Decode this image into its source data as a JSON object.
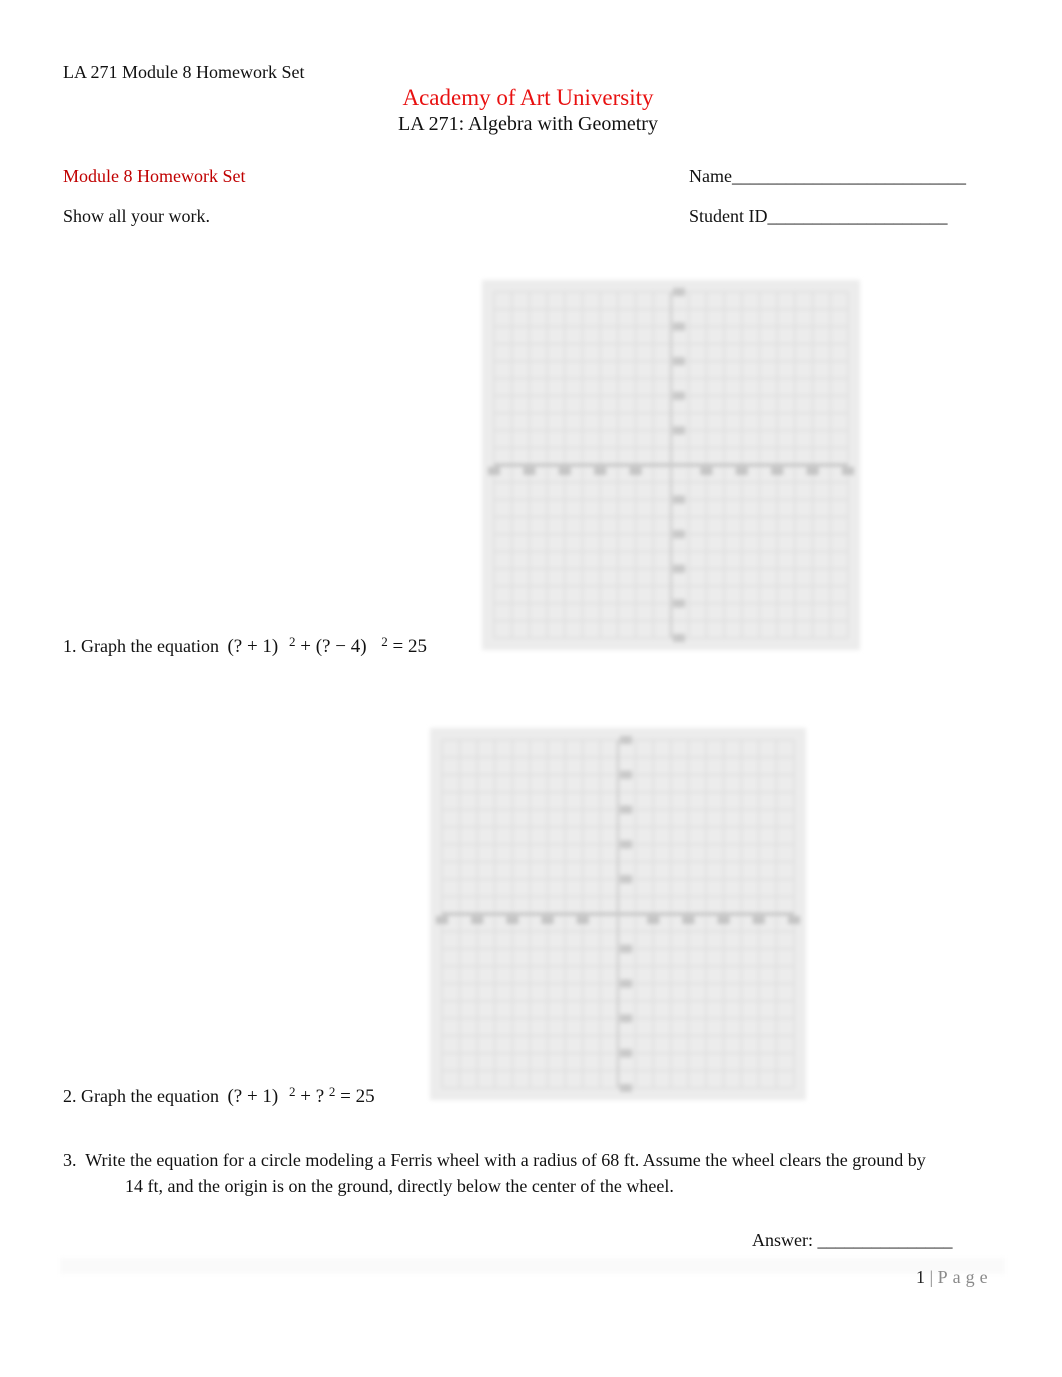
{
  "header": {
    "running_title": "LA 271 Module 8 Homework Set",
    "institution": "Academy of Art University",
    "course": "LA 271: Algebra with Geometry"
  },
  "intro": {
    "set_title": "Module 8 Homework Set",
    "instruction": "Show all your work.",
    "name_label": "Name",
    "name_blank": "__________________________",
    "student_id_label": "Student ID",
    "student_id_blank": "____________________"
  },
  "questions": [
    {
      "number": "1.",
      "prompt": "Graph the equation",
      "equation": {
        "term1": "(? + 1)",
        "exp1": "2",
        "plus": "+",
        "term2": "(? − 4)",
        "exp2": "2",
        "rhs": "= 25"
      },
      "grid": {
        "x_range": [
          -10,
          10
        ],
        "y_range": [
          -10,
          10
        ],
        "blurred": true
      }
    },
    {
      "number": "2.",
      "prompt": "Graph the equation",
      "equation": {
        "term1": "(? + 1)",
        "exp1": "2",
        "plus": "+",
        "term2": "?",
        "exp2": "2",
        "rhs": "= 25"
      },
      "grid": {
        "x_range": [
          -10,
          10
        ],
        "y_range": [
          -10,
          10
        ],
        "blurred": true
      }
    },
    {
      "number": "3.",
      "line1": "Write the equation for a circle modeling a Ferris wheel with a radius of 68 ft. Assume the wheel clears the ground by",
      "line2": "14 ft, and the origin is on the ground, directly below the center of the wheel.",
      "answer_label": "Answer:",
      "answer_blank": "_______________"
    }
  ],
  "footer": {
    "page_number": "1",
    "separator": "|",
    "page_word": "Page"
  },
  "colors": {
    "institution_red": "#e81010",
    "heading_red": "#c00000",
    "grid_background": "#ececec"
  }
}
